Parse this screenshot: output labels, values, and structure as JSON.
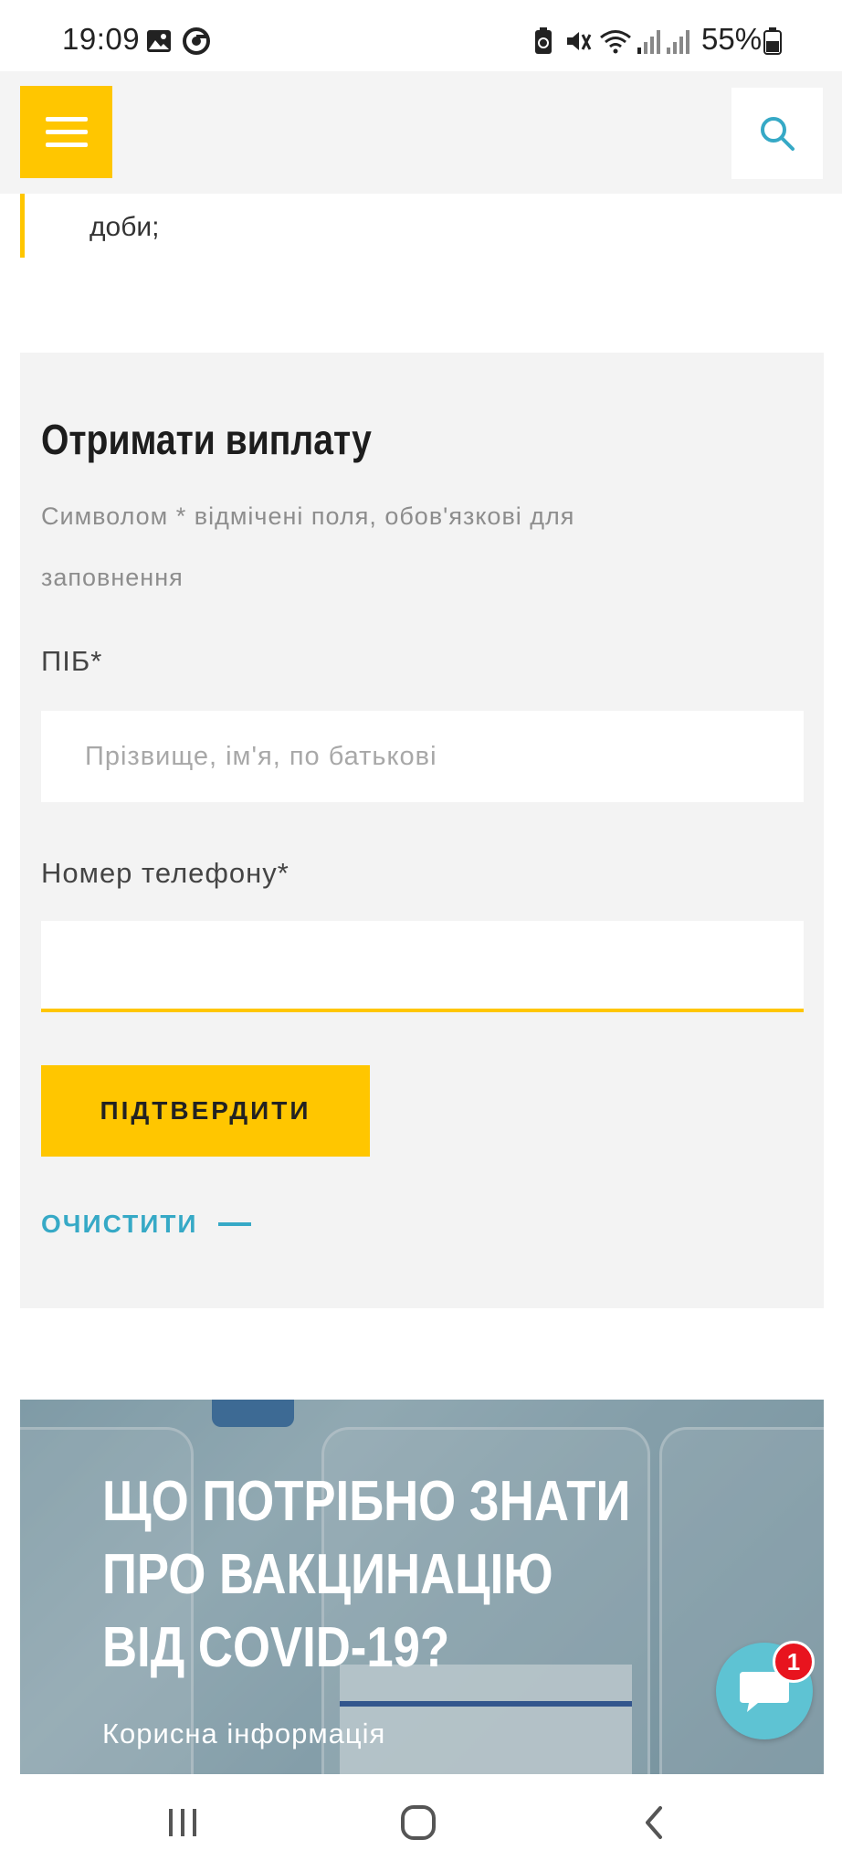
{
  "status_bar": {
    "time": "19:09",
    "battery_percent": "55%",
    "icons": [
      "gallery-icon",
      "chrome-icon",
      "battery-saver-icon",
      "mute-icon",
      "wifi-icon",
      "signal-icon",
      "signal-icon",
      "battery-icon"
    ]
  },
  "header": {
    "menu_icon": "hamburger-menu-icon",
    "search_icon": "search-icon",
    "accent_color": "#ffc600"
  },
  "quote": {
    "text": "доби;"
  },
  "form": {
    "title": "Отримати виплату",
    "note": "Символом * відмічені поля, обов'язкові для заповнення",
    "fields": [
      {
        "label": "ПІБ*",
        "placeholder": "Прізвище, ім'я, по батькові",
        "value": ""
      },
      {
        "label": "Номер телефону*",
        "placeholder": "",
        "value": ""
      }
    ],
    "submit_label": "ПІДТВЕРДИТИ",
    "clear_label": "ОЧИСТИТИ",
    "link_color": "#36a9c6"
  },
  "article": {
    "title": "ЩО ПОТРІБНО ЗНАТИ ПРО ВАКЦИНАЦІЮ ВІД COVID-19?",
    "category": "Корисна інформація"
  },
  "chat": {
    "icon": "chat-bubble-icon",
    "badge_count": "1"
  },
  "nav_bar": {
    "buttons": [
      "recent-apps-icon",
      "home-icon",
      "back-icon"
    ]
  }
}
